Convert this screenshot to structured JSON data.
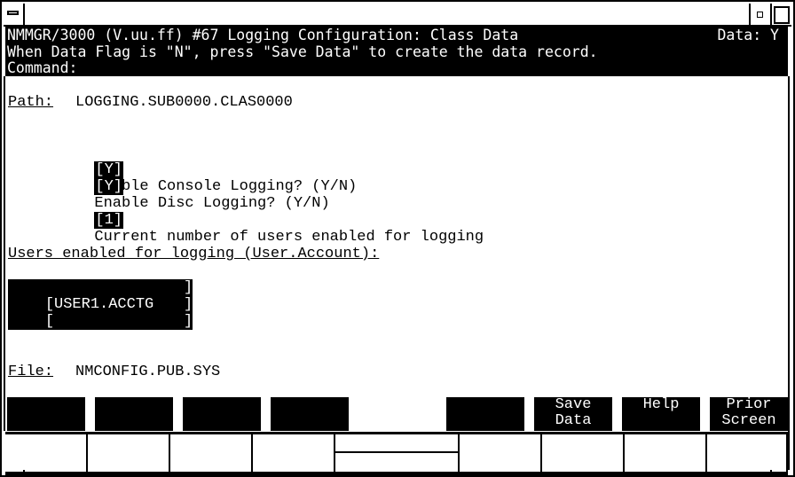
{
  "window": {
    "title": "",
    "system_menu_icon": "system-menu-bar",
    "minimize_icon": "small-square",
    "maximize_icon": "large-square"
  },
  "header": {
    "line1": "NMMGR/3000 (V.uu.ff) #67 Logging Configuration: Class Data",
    "data_flag_label": "Data: Y",
    "line2": "When Data Flag is \"N\", press \"Save Data\" to create the data record.",
    "command_label": "Command:",
    "command_value": ""
  },
  "path": {
    "label": "Path:",
    "value": "LOGGING.SUB0000.CLAS0000"
  },
  "options": [
    {
      "value": "[Y]",
      "label": "Enable Console Logging? (Y/N)"
    },
    {
      "value": "[Y]",
      "label": "Enable Disc Logging? (Y/N)"
    }
  ],
  "user_count": {
    "value": "[1]",
    "label": "Current number of users enabled for logging"
  },
  "users_section": {
    "label": "Users enabled for logging (User.Account):",
    "entries": [
      {
        "open": "[",
        "value": "USER1.ACCTG",
        "close": "]"
      },
      {
        "open": "[",
        "value": "",
        "close": "]"
      },
      {
        "open": "[",
        "value": "",
        "close": "]"
      }
    ]
  },
  "file": {
    "label": "File:",
    "value": "NMCONFIG.PUB.SYS"
  },
  "function_keys": [
    {
      "line1": "",
      "line2": ""
    },
    {
      "line1": "",
      "line2": ""
    },
    {
      "line1": "",
      "line2": ""
    },
    {
      "line1": "",
      "line2": ""
    },
    {
      "line1": "",
      "line2": ""
    },
    {
      "line1": "Save",
      "line2": "Data"
    },
    {
      "line1": "Help",
      "line2": ""
    },
    {
      "line1": "Prior",
      "line2": "Screen"
    }
  ]
}
